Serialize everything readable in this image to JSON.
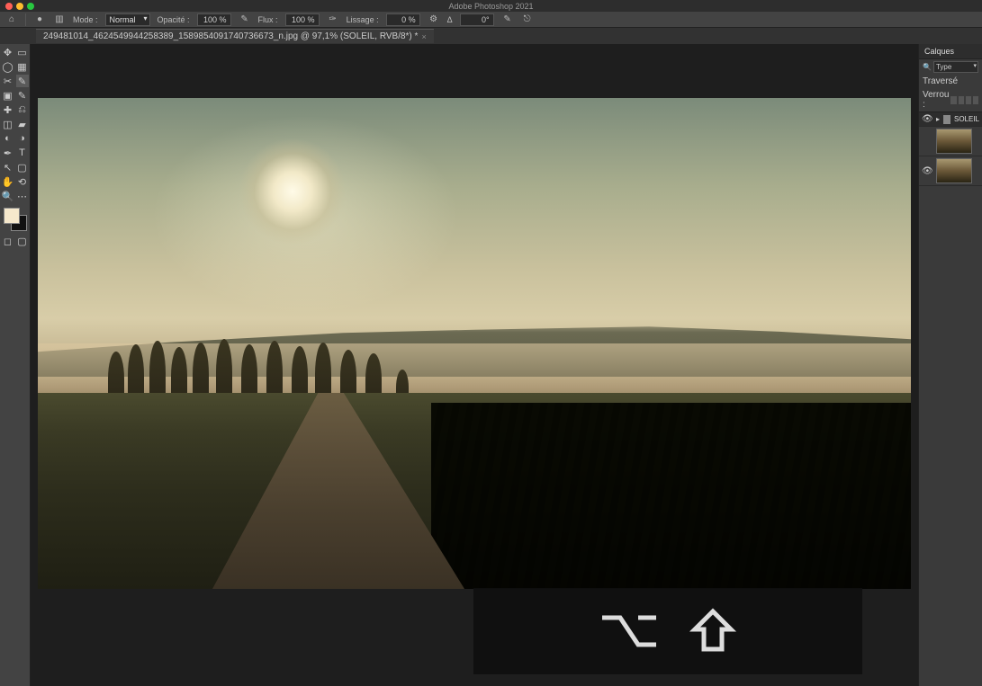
{
  "app_title": "Adobe Photoshop 2021",
  "options_bar": {
    "mode_label": "Mode :",
    "mode_value": "Normal",
    "opacity_label": "Opacité :",
    "opacity_value": "100 %",
    "flux_label": "Flux :",
    "flux_value": "100 %",
    "lissage_label": "Lissage :",
    "lissage_value": "0 %",
    "angle_label": "Δ",
    "angle_value": "0°"
  },
  "document_tab": "249481014_4624549944258389_1589854091740736673_n.jpg @ 97,1% (SOLEIL, RVB/8*) *",
  "layers_panel": {
    "title": "Calques",
    "filter_kind": "Type",
    "blend_mode": "Traversé",
    "lock_label": "Verrou :",
    "group_name": "SOLEIL"
  }
}
